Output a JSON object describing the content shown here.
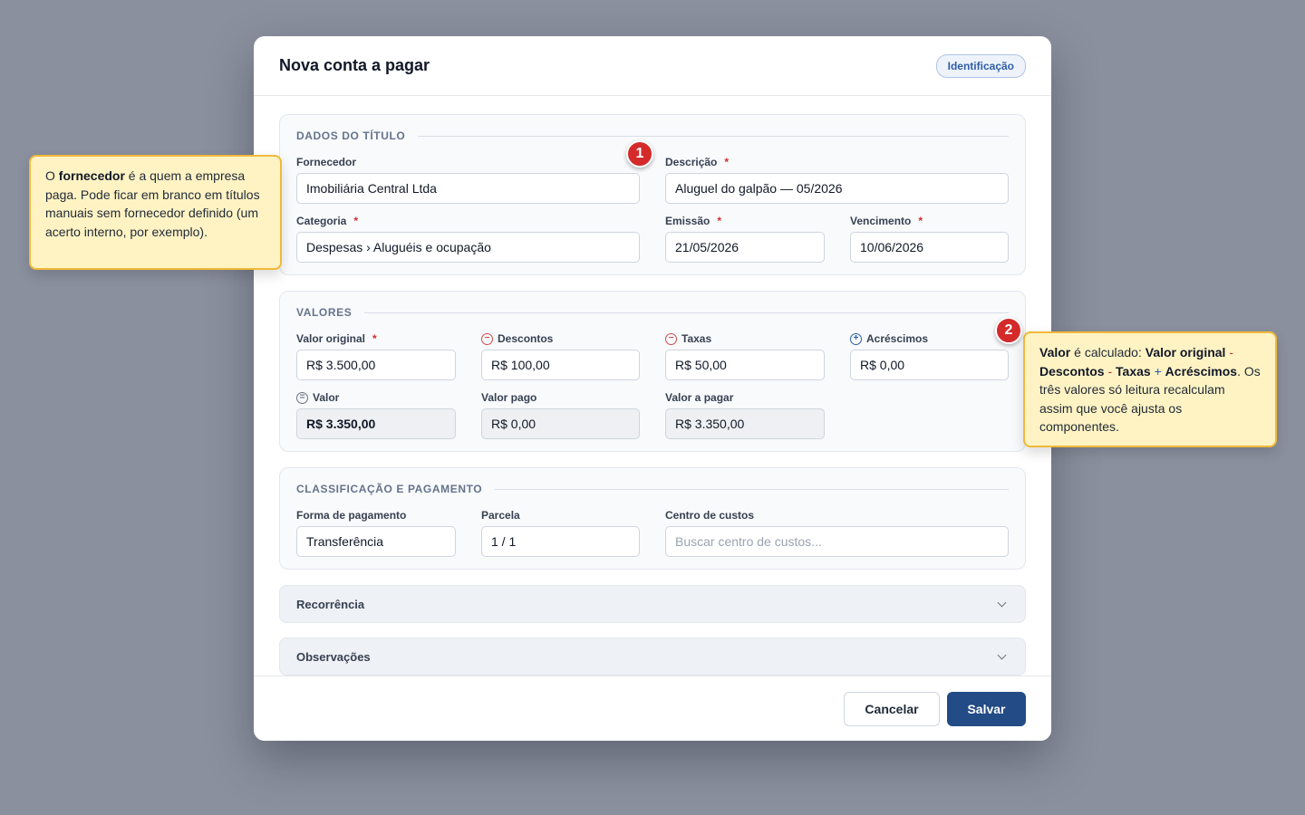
{
  "modal": {
    "title": "Nova conta a pagar",
    "badge": "Identificação"
  },
  "dados": {
    "section_title": "DADOS DO TÍTULO",
    "fornecedor_label": "Fornecedor",
    "fornecedor_value": "Imobiliária Central Ltda",
    "descricao_label": "Descrição",
    "descricao_value": "Aluguel do galpão — 05/2026",
    "categoria_label": "Categoria",
    "categoria_value": "Despesas › Aluguéis e ocupação",
    "emissao_label": "Emissão",
    "emissao_value": "21/05/2026",
    "vencimento_label": "Vencimento",
    "vencimento_value": "10/06/2026"
  },
  "valores": {
    "section_title": "VALORES",
    "original_label": "Valor original",
    "original_value": "R$ 3.500,00",
    "descontos_label": "Descontos",
    "descontos_value": "R$ 100,00",
    "taxas_label": "Taxas",
    "taxas_value": "R$ 50,00",
    "acrescimos_label": "Acréscimos",
    "acrescimos_value": "R$ 0,00",
    "valor_label": "Valor",
    "valor_value": "R$ 3.350,00",
    "pago_label": "Valor pago",
    "pago_value": "R$ 0,00",
    "apagar_label": "Valor a pagar",
    "apagar_value": "R$ 3.350,00"
  },
  "classificacao": {
    "section_title": "CLASSIFICAÇÃO E PAGAMENTO",
    "forma_label": "Forma de pagamento",
    "forma_value": "Transferência",
    "parcela_label": "Parcela",
    "parcela_value": "1 / 1",
    "centro_label": "Centro de custos",
    "centro_placeholder": "Buscar centro de custos..."
  },
  "accordions": {
    "recorrencia": "Recorrência",
    "observacoes": "Observações"
  },
  "footer": {
    "cancel": "Cancelar",
    "save": "Salvar"
  },
  "required_mark": "*",
  "callout1": {
    "marker": "1",
    "t1": "O ",
    "b1": "fornecedor",
    "t2": " é a quem a empresa paga. Pode ficar em branco em títulos manuais sem fornecedor definido (um acerto interno, por exemplo)."
  },
  "callout2": {
    "marker": "2",
    "b1": "Valor",
    "t1": " é calculado: ",
    "b2": "Valor original",
    "op1": " - ",
    "b3": "Descontos",
    "op2": " - ",
    "b4": "Taxas",
    "op3": " + ",
    "b5": "Acréscimos",
    "t2": ". Os três valores só leitura recalculam assim que você ajusta os componentes."
  },
  "icons": {
    "minus": "−",
    "plus": "+",
    "equal": "="
  },
  "colors": {
    "accent": "#234b85",
    "required": "#d12b2b",
    "callout_bg": "#fff3c4",
    "callout_border": "#f1b93a",
    "marker": "#d42a2a"
  }
}
